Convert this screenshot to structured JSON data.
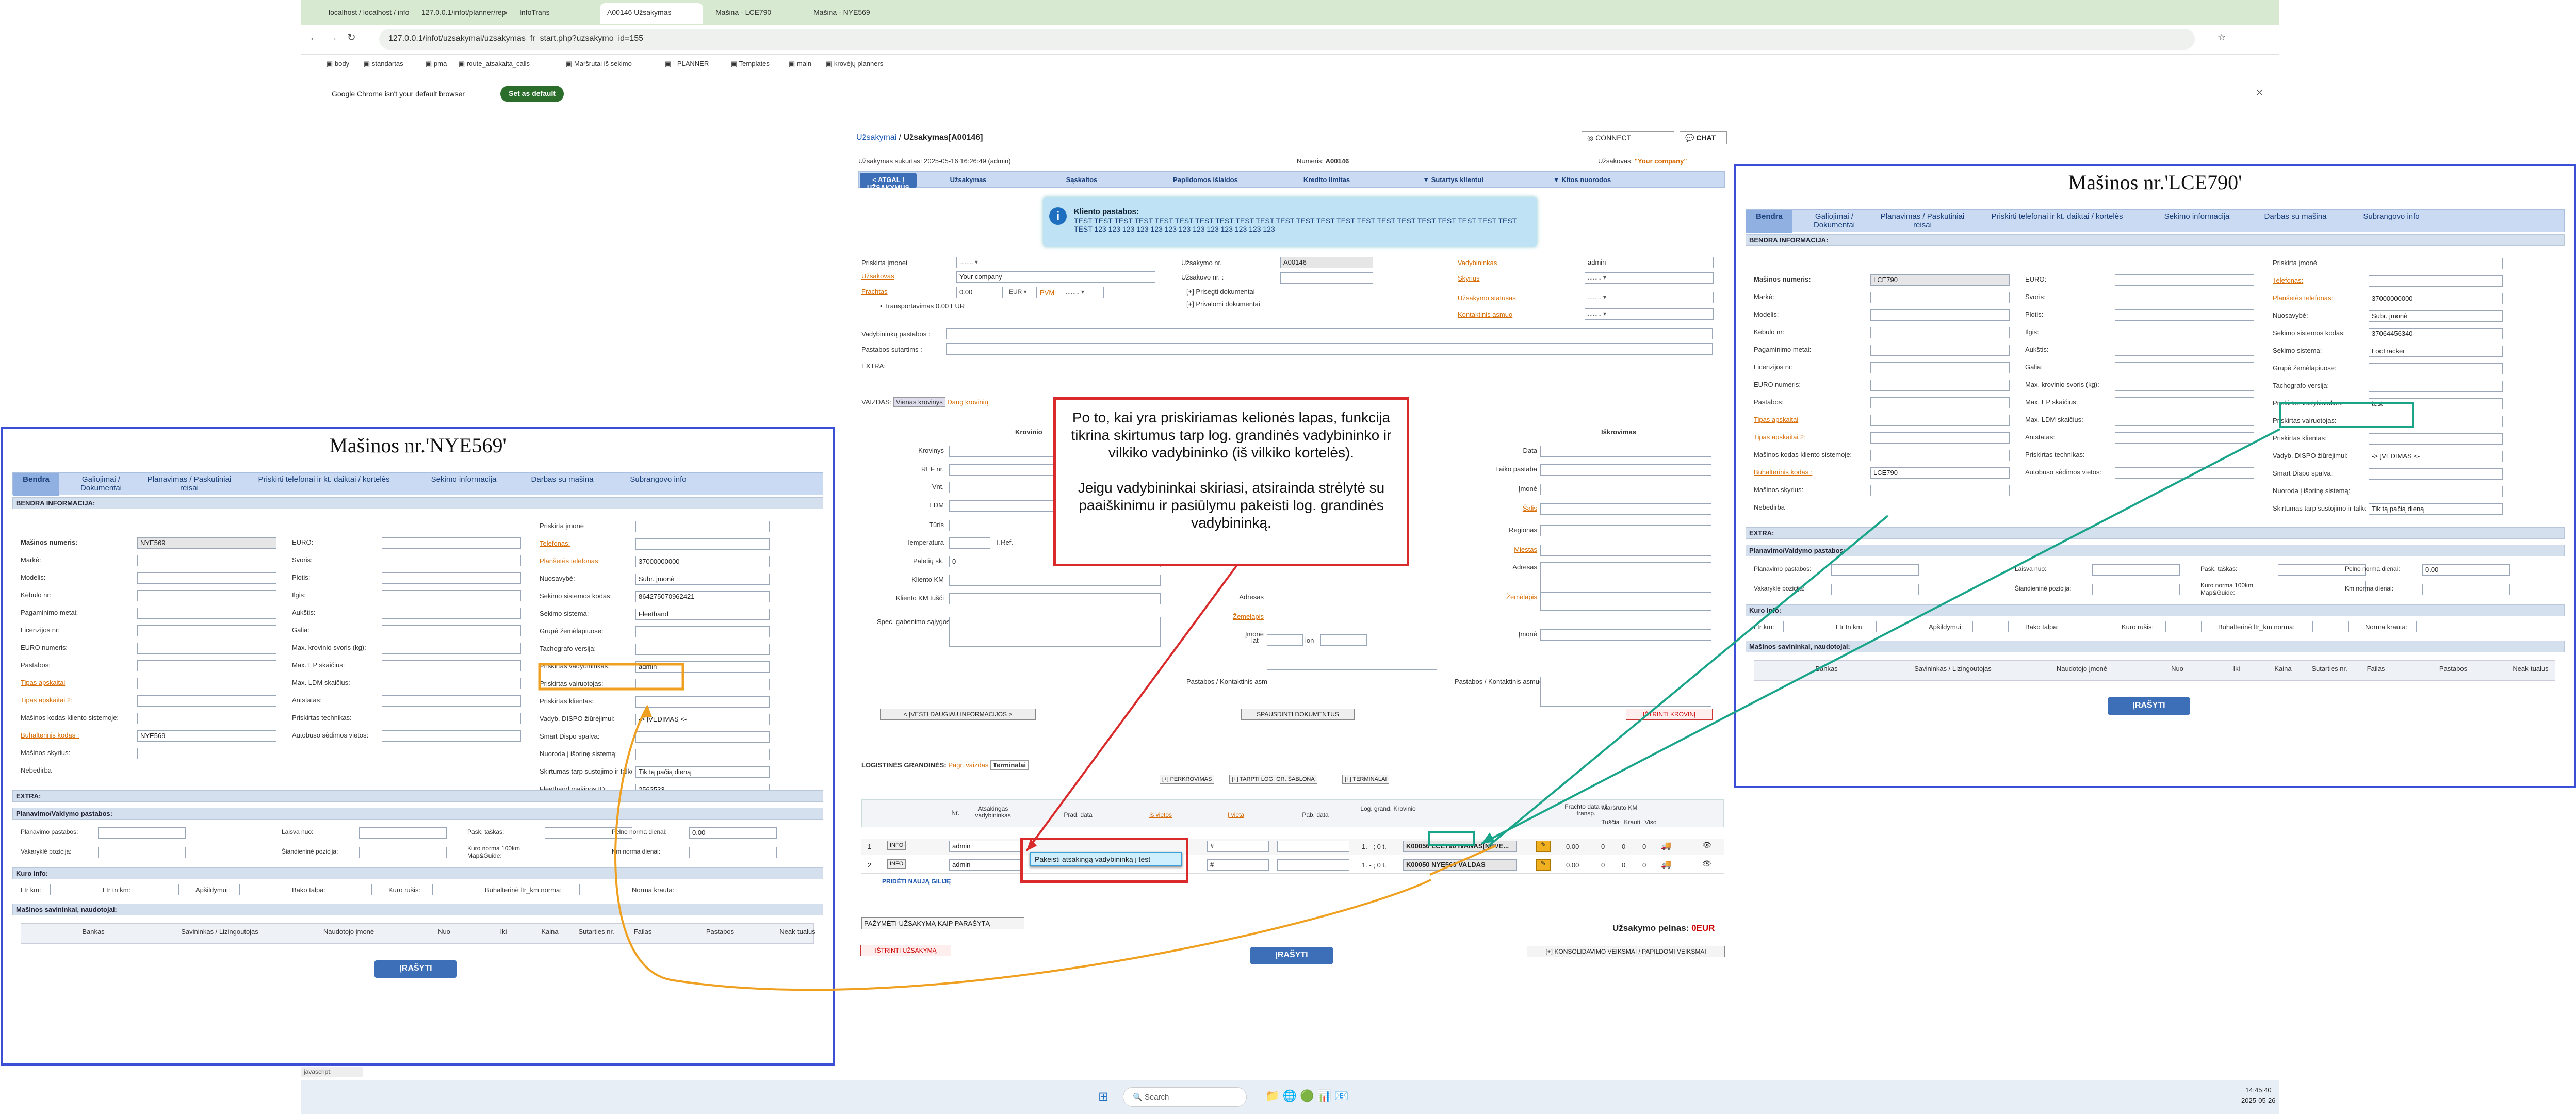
{
  "browser": {
    "tabs": [
      "localhost / localhost / infot_2 / ...",
      "127.0.0.1/infot/planner/report...",
      "InfoTrans",
      "A00146 Užsakymas",
      "Mašina - LCE790",
      "Mašina - NYE569"
    ],
    "url": "127.0.0.1/infot/uzsakymai/uzsakymas_fr_start.php?uzsakymo_id=155",
    "bookmarks": [
      "body",
      "standartas",
      "pma",
      "route_atsakaita_calls",
      "Maršrutai iš sekimo",
      "- PLANNER -",
      "Templates",
      "main",
      "krovėjų planners"
    ],
    "infobar_text": "Google Chrome isn't your default browser",
    "infobar_button": "Set as default"
  },
  "order": {
    "breadcrumb_link": "Užsakymai",
    "breadcrumb_title": "Užsakymas[A00146]",
    "connect": "CONNECT",
    "chat": "CHAT",
    "created": "Užsakymas sukurtas: 2025-05-16 16:26:49 (admin)",
    "number_label": "Numeris:",
    "number": "A00146",
    "client_label": "Užsakovas:",
    "client": "\"Your company\"",
    "nav": [
      "< ATGAL Į UŽSAKYMUS",
      "Užsakymas",
      "Sąskaitos",
      "Papildomos išlaidos",
      "Kredito limitas",
      "▼ Sutartys klientui",
      "▼ Kitos nuorodos"
    ],
    "client_note_title": "Kliento pastabos:",
    "client_note": "TEST TEST TEST TEST TEST TEST TEST TEST TEST TEST TEST TEST TEST TEST TEST TEST TEST TEST TEST TEST TEST TEST TEST 123 123 123 123 123 123 123 123 123 123 123 123 123",
    "fields": {
      "company_label": "Priskirta įmonei",
      "client_label": "Užsakovas",
      "client_value": "Your company",
      "freight_label": "Frachtas",
      "freight_value": "0.00",
      "currency": "EUR",
      "pvm": "PVM",
      "transport": "Transportavimas  0.00 EUR",
      "order_no_label": "Užsakymo nr.",
      "order_no": "A00146",
      "client_no_label": "Užsakovo nr. :",
      "attach1": "[+] Prisegti dokumentai",
      "attach2": "[+] Privalomi dokumentai",
      "manager_label": "Vadybininkas",
      "manager_value": "admin",
      "sector_label": "Skyrius",
      "status_label": "Užsakymo statusas",
      "contacts_label": "Kontaktinis asmuo",
      "manager_notes_label": "Vadybininkų pastabos :",
      "contract_notes_label": "Pastabos sutartims :",
      "extra_label": "EXTRA:"
    },
    "loading": {
      "tab_label": "VAIZDAS:",
      "tab1": "Vienas krovinys",
      "tab2": "Daug krovinių",
      "loading_title": "Krovinio",
      "unloading_title": "Iškrovimas",
      "left_fields": [
        "Krovinys",
        "REF nr.",
        "Vnt.",
        "LDM",
        "Tūris",
        "Temperatūra",
        "Paletių sk.",
        "Kliento KM",
        "Kliento KM tušči",
        "Spec. gabenimo sąlygos"
      ],
      "tref": "T.Ref.",
      "pallets": "0",
      "right_fields": [
        "Data",
        "Laiko pastaba",
        "Įmonė",
        "Šalis",
        "Regionas",
        "Miestas",
        "Adresas",
        "Žemėlapis",
        "Įmonė",
        "Pastabos / Kontaktinis asmuo"
      ],
      "mid_fields": [
        "Adresas",
        "Žemėlapis",
        "Įmonė",
        "Pastabos / Kontaktinis asmuo"
      ],
      "lat": "lat",
      "lon": "lon",
      "btn_more": "< ĮVESTI DAUGIAU INFORMACIJOS >",
      "btn_print": "SPAUSDINTI DOKUMENTUS",
      "btn_delete": "IŠTRINTI KROVINĮ"
    },
    "chains": {
      "title": "LOGISTINĖS GRANDINĖS:",
      "prov": "Pagr. vaizdas",
      "term": "Terminalai",
      "actions": [
        "[+] PERKROVIMAS",
        "[+] TARPTI LOG. GR. ŠABLONĄ",
        "[+] TERMINALAI"
      ],
      "headers": [
        "Nr.",
        "Atsakingas vadybininkas",
        "Prad. data",
        "Iš vietos",
        "Į vietą",
        "Pab. data",
        "Log. grand. Krovinio",
        "Frachto data už transp.",
        "Maršruto KM",
        "Tuščia",
        "Krauti",
        "Viso"
      ],
      "rows": [
        {
          "nr": "1",
          "manager": "admin",
          "truck": "K00056 LCE790 IVANAS[NEVE...",
          "fr": "0.00",
          "km1": "0",
          "km2": "0",
          "km3": "0",
          "code": "1. - ; 0 t."
        },
        {
          "nr": "2",
          "manager": "admin",
          "truck": "K00050 NYE569 VALDAS",
          "fr": "0.00",
          "km1": "0",
          "km2": "0",
          "km3": "0",
          "code": "1. - ; 0 t."
        }
      ],
      "tooltip": "Pakeisti atsakingą vadybininką į test",
      "info": "INFO",
      "add_chain": "PRIDĖTI NAUJĄ GILIJĘ",
      "mark_button": "PAŽYMĖTI UŽSAKYMĄ KAIP PARAŠYTĄ",
      "profit_label": "Užsakymo pelnas:",
      "profit": "0EUR",
      "delete_order": "IŠTRINTI UŽSAKYMĄ",
      "save": "ĮRAŠYTI",
      "consolidate": "[+] KONSOLIDAVIMO VEIKSMAI / PAPILDOMI VEIKSMAI"
    }
  },
  "callout": {
    "p1": "Po to, kai yra priskiriamas kelionės lapas, funkcija tikrina skirtumus tarp log. grandinės vadybininko ir vilkiko vadybininko (iš vilkiko kortelės).",
    "p2": "Jeigu vadybininkai skiriasi, atsirainda strėlytė su paaiškinimu ir pasiūlymu pakeisti log. grandinės vadybininką."
  },
  "left_panel": {
    "title": "Mašinos nr.'NYE569'",
    "tabs": [
      "Bendra",
      "Galiojimai / Dokumentai",
      "Planavimas / Paskutiniai reisai",
      "Priskirti telefonai ir kt. daiktai / kortelės",
      "Sekimo informacija",
      "Darbas su mašina",
      "Subrangovo info"
    ],
    "section": "BENDRA INFORMACIJA:",
    "col1": [
      [
        "Mašinos numeris:",
        "NYE569"
      ],
      [
        "Markė:",
        ""
      ],
      [
        "Modelis:",
        ""
      ],
      [
        "Kėbulo nr:",
        ""
      ],
      [
        "Pagaminimo metai:",
        ""
      ],
      [
        "Licenzijos nr:",
        ""
      ],
      [
        "EURO numeris:",
        ""
      ],
      [
        "Pastabos:",
        ""
      ],
      [
        "Tipas apskaitai",
        ""
      ],
      [
        "Tipas apskaitai 2:",
        ""
      ],
      [
        "Mašinos kodas kliento sistemoje:",
        ""
      ],
      [
        "Buhalterinis kodas :",
        "NYE569"
      ],
      [
        "Mašinos skyrius:",
        ""
      ],
      [
        "Nebedirba",
        ""
      ]
    ],
    "col2": [
      [
        "EURO:",
        ""
      ],
      [
        "Svoris:",
        ""
      ],
      [
        "Plotis:",
        ""
      ],
      [
        "Ilgis:",
        ""
      ],
      [
        "Aukštis:",
        ""
      ],
      [
        "Galia:",
        ""
      ],
      [
        "Max. krovinio svoris (kg):",
        ""
      ],
      [
        "Max. EP skaičius:",
        ""
      ],
      [
        "Max. LDM skaičius:",
        ""
      ],
      [
        "Antstatas:",
        ""
      ],
      [
        "Priskirtas technikas:",
        ""
      ],
      [
        "Autobuso sėdimos vietos:",
        ""
      ]
    ],
    "col3": [
      [
        "Priskirta įmonė",
        ""
      ],
      [
        "Telefonas:",
        ""
      ],
      [
        "Planšetės telefonas:",
        "37000000000"
      ],
      [
        "Nuosavybė:",
        "Subr. įmonė"
      ],
      [
        "Sekimo sistemos kodas:",
        "864275070962421"
      ],
      [
        "Sekimo sistema:",
        "Fleethand"
      ],
      [
        "Grupė žemėlapiuose:",
        ""
      ],
      [
        "Tachografo versija:",
        ""
      ],
      [
        "Priskirtas vadybininkas:",
        "admin"
      ],
      [
        "Priskirtas vairuotojas:",
        ""
      ],
      [
        "Priskirtas klientas:",
        ""
      ],
      [
        "Vadyb. DISPO žiūrėjimui:",
        "-> ĮVEDIMAS <-"
      ],
      [
        "Smart Dispo spalva:",
        ""
      ],
      [
        "Nuoroda į išorinę sistemą:",
        ""
      ],
      [
        "Skirtumas tarp sustojimo ir talko datų (min.):",
        "Tik tą pačią dieną"
      ],
      [
        "Fleethand mašinos ID:",
        "2562533"
      ]
    ],
    "extra": "EXTRA:",
    "planning": "Planavimo/Valdymo pastabos:",
    "plan_fields": [
      "Planavimo pastabos:",
      "Laisva nuo:",
      "Pask. taškas:",
      "Pelno norma dienai:",
      "Vakaryklė pozicija:",
      "Šiandieninė pozicija:",
      "Kuro norma 100km Map&Guide:",
      "Km norma dienai:"
    ],
    "profit_norm": "0.00",
    "fuel": "Kuro info:",
    "fuel_fields": [
      "Ltr km:",
      "Ltr tn km:",
      "Apšildymui:",
      "Bako talpa:",
      "Kuro rūšis:",
      "Buhalterinė ltr_km norma:",
      "Norma krauta:"
    ],
    "owners": "Mašinos savininkai, naudotojai:",
    "owner_headers": [
      "Bankas",
      "Savininkas / Lizingoutojas",
      "Naudotojo įmonė",
      "Nuo",
      "Iki",
      "Kaina",
      "Sutarties nr.",
      "Failas",
      "Pastabos",
      "Neak-tualus"
    ],
    "save": "ĮRAŠYTI"
  },
  "right_panel": {
    "title": "Mašinos nr.'LCE790'",
    "tabs": [
      "Bendra",
      "Galiojimai / Dokumentai",
      "Planavimas / Paskutiniai reisai",
      "Priskirti telefonai ir kt. daiktai / kortelės",
      "Sekimo informacija",
      "Darbas su mašina",
      "Subrangovo info"
    ],
    "section": "BENDRA INFORMACIJA:",
    "col1": [
      [
        "Mašinos numeris:",
        "LCE790"
      ],
      [
        "Markė:",
        ""
      ],
      [
        "Modelis:",
        ""
      ],
      [
        "Kėbulo nr:",
        ""
      ],
      [
        "Pagaminimo metai:",
        ""
      ],
      [
        "Licenzijos nr:",
        ""
      ],
      [
        "EURO numeris:",
        ""
      ],
      [
        "Pastabos:",
        ""
      ],
      [
        "Tipas apskaitai",
        ""
      ],
      [
        "Tipas apskaitai 2:",
        ""
      ],
      [
        "Mašinos kodas kliento sistemoje:",
        ""
      ],
      [
        "Buhalterinis kodas :",
        "LCE790"
      ],
      [
        "Mašinos skyrius:",
        ""
      ],
      [
        "Nebedirba",
        ""
      ]
    ],
    "col2": [
      [
        "EURO:",
        ""
      ],
      [
        "Svoris:",
        ""
      ],
      [
        "Plotis:",
        ""
      ],
      [
        "Ilgis:",
        ""
      ],
      [
        "Aukštis:",
        ""
      ],
      [
        "Galia:",
        ""
      ],
      [
        "Max. krovinio svoris (kg):",
        ""
      ],
      [
        "Max. EP skaičius:",
        ""
      ],
      [
        "Max. LDM skaičius:",
        ""
      ],
      [
        "Antstatas:",
        ""
      ],
      [
        "Priskirtas technikas:",
        ""
      ],
      [
        "Autobuso sėdimos vietos:",
        ""
      ]
    ],
    "col3": [
      [
        "Priskirta įmonė",
        ""
      ],
      [
        "Telefonas:",
        ""
      ],
      [
        "Planšetės telefonas:",
        "37000000000"
      ],
      [
        "Nuosavybė:",
        "Subr. įmonė"
      ],
      [
        "Sekimo sistemos kodas:",
        "37064456340"
      ],
      [
        "Sekimo sistema:",
        "LocTracker"
      ],
      [
        "Grupė žemėlapiuose:",
        ""
      ],
      [
        "Tachografo versija:",
        ""
      ],
      [
        "Priskirtas vadybininkas:",
        "test"
      ],
      [
        "Priskirtas vairuotojas:",
        ""
      ],
      [
        "Priskirtas klientas:",
        ""
      ],
      [
        "Vadyb. DISPO žiūrėjimui:",
        "-> ĮVEDIMAS <-"
      ],
      [
        "Smart Dispo spalva:",
        ""
      ],
      [
        "Nuoroda į išorinę sistemą:",
        ""
      ],
      [
        "Skirtumas tarp sustojimo ir talko datų (min.):",
        "Tik tą pačią dieną"
      ]
    ],
    "extra": "EXTRA:",
    "planning": "Planavimo/Valdymo pastabos:",
    "plan_fields": [
      "Planavimo pastabos:",
      "Laisva nuo:",
      "Pask. taškas:",
      "Pelno norma dienai:",
      "Vakaryklė pozicija:",
      "Šiandieninė pozicija:",
      "Kuro norma 100km Map&Guide:",
      "Km norma dienai:"
    ],
    "profit_norm": "0.00",
    "fuel": "Kuro info:",
    "fuel_fields": [
      "Ltr km:",
      "Ltr tn km:",
      "Apšildymui:",
      "Bako talpa:",
      "Kuro rūšis:",
      "Buhalterinė ltr_km norma:",
      "Norma krauta:"
    ],
    "owners": "Mašinos savininkai, naudotojai:",
    "owner_headers": [
      "Bankas",
      "Savininkas / Lizingoutojas",
      "Naudotojo įmonė",
      "Nuo",
      "Iki",
      "Kaina",
      "Sutarties nr.",
      "Failas",
      "Pastabos",
      "Neak-tualus"
    ],
    "save": "ĮRAŠYTI"
  },
  "statusbar": "javascript:",
  "taskbar": {
    "search": "Search",
    "time": "14:45:40",
    "date": "2025-05-26"
  },
  "colors": {
    "panel_border": "#3b4fd6",
    "callout": "#d92b2b",
    "orange_arrow": "#f0a020",
    "teal_arrow": "#1aa58a"
  }
}
